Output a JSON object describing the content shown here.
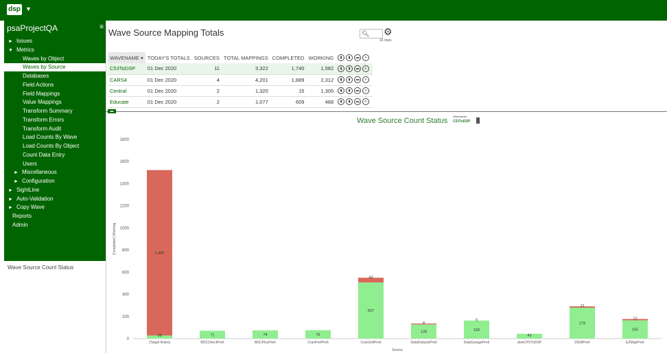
{
  "app": {
    "logo": "dsp",
    "project": "psaProjectQA"
  },
  "sidebar": {
    "items": [
      {
        "label": "Issues",
        "arrow": "►"
      },
      {
        "label": "Metrics",
        "arrow": "▼"
      },
      {
        "label": "Waves by Object",
        "arrow": ""
      },
      {
        "label": "Waves by Source",
        "arrow": "",
        "selected": true
      },
      {
        "label": "Databases",
        "arrow": ""
      },
      {
        "label": "Field Actions",
        "arrow": ""
      },
      {
        "label": "Field Mappings",
        "arrow": ""
      },
      {
        "label": "Value Mappings",
        "arrow": ""
      },
      {
        "label": "Transform Summary",
        "arrow": ""
      },
      {
        "label": "Transform Errors",
        "arrow": ""
      },
      {
        "label": "Transform Audit",
        "arrow": ""
      },
      {
        "label": "Load Counts By Wave",
        "arrow": ""
      },
      {
        "label": "Load Counts By Object",
        "arrow": ""
      },
      {
        "label": "Count Data Entry",
        "arrow": ""
      },
      {
        "label": "Users",
        "arrow": ""
      },
      {
        "label": "Miscellaneous",
        "arrow": "►"
      },
      {
        "label": "Configuration",
        "arrow": "►"
      },
      {
        "label": "SightLine",
        "arrow": "►"
      },
      {
        "label": "Auto-Validation",
        "arrow": "►"
      },
      {
        "label": "Copy Wave",
        "arrow": "►"
      },
      {
        "label": "Reports",
        "arrow": ""
      },
      {
        "label": "Admin",
        "arrow": ""
      }
    ],
    "bottom_label": "Wave Source Count Status"
  },
  "main": {
    "title": "Wave Source Mapping Totals",
    "row_count": "16 rows",
    "columns": [
      "WAVENAME ▾",
      "TODAY'S TOTALS",
      "SOURCES",
      "TOTAL MAPPINGS",
      "COMPLETED",
      "WORKING"
    ],
    "rows": [
      [
        "C53ToDSP",
        "01 Dec 2020",
        "11",
        "3,322",
        "1,740",
        "1,582"
      ],
      [
        "CARS4",
        "01 Dec 2020",
        "4",
        "4,201",
        "1,889",
        "2,312"
      ],
      [
        "Central",
        "01 Dec 2020",
        "2",
        "1,320",
        "15",
        "1,305"
      ],
      [
        "Educate",
        "01 Dec 2020",
        "2",
        "1,077",
        "609",
        "468"
      ]
    ]
  },
  "chart_header": {
    "title": "Wave Source Count Status",
    "wave_label": "Wavename",
    "wave_value": "C53ToDSP"
  },
  "chart_data": {
    "type": "bar",
    "stacked": true,
    "categories": [
      "(Target Rules)",
      "BDCDirectPre6",
      "BDCPlusPre6",
      "CranPortPre6",
      "CranSoftPre6",
      "DataDialysisPre6",
      "DataGaragePre6",
      "dowCPSToDSP",
      "DSWPre6",
      "EZMapPre6"
    ],
    "series": [
      {
        "color": "#90ee90",
        "values": [
          28,
          71,
          74,
          76,
          507,
          128,
          163,
          43,
          279,
          165
        ]
      },
      {
        "color": "#d9685b",
        "values": [
          1495,
          0,
          0,
          0,
          43,
          8,
          0,
          0,
          12,
          12
        ]
      }
    ],
    "labels_completed": [
      "28",
      "71",
      "74",
      "76",
      "507",
      "128",
      "163",
      "43",
      "279",
      "165"
    ],
    "labels_working": [
      "1,495",
      "",
      "",
      "",
      "43",
      "8",
      "0",
      "",
      "12",
      "12"
    ],
    "ylabel": "Completed | Working",
    "xlabel": "Source",
    "yticks": [
      "0",
      "200",
      "400",
      "600",
      "800",
      "1000",
      "1200",
      "1400",
      "1600",
      "1800"
    ],
    "ylim": [
      0,
      1800
    ],
    "grid": false
  }
}
